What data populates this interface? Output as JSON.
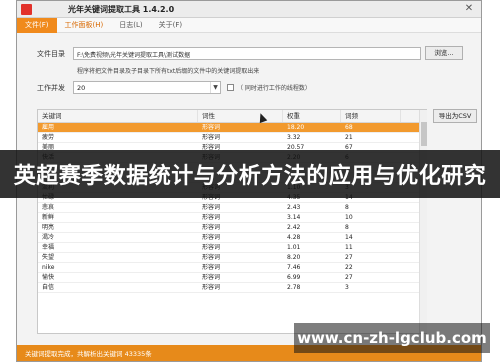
{
  "window": {
    "title": "光年关键词提取工具 1.4.2.0",
    "close_glyph": "✕"
  },
  "menu": [
    {
      "label": "文件(F)",
      "active": true
    },
    {
      "label": "工作面板(H)",
      "highlight": true
    },
    {
      "label": "日志(L)"
    },
    {
      "label": "关于(F)"
    }
  ],
  "form": {
    "dir_label": "文件目录",
    "dir_value": "F:\\免费视频\\光年关键词提取工具\\测试数据",
    "browse_label": "浏览...",
    "hint": "程序将把文件目录及子目录下所有txt后缀的文件中的关键词提取出来",
    "concurrency_label": "工作并发",
    "concurrency_value": "20",
    "checkbox_label": "（ 同时进行工作的线程数）"
  },
  "table": {
    "columns": [
      "关键词",
      "词性",
      "权重",
      "词频"
    ],
    "rows": [
      [
        "雇用",
        "形容词",
        "18.20",
        "68"
      ],
      [
        "疲劳",
        "形容词",
        "3.32",
        "21"
      ],
      [
        "美丽",
        "形容词",
        "20.57",
        "67"
      ],
      [
        "快活",
        "形容词",
        "2.20",
        "6"
      ],
      [
        "",
        "",
        "",
        ""
      ],
      [
        "",
        "",
        "",
        ""
      ],
      [
        "流利",
        "形容词",
        "1.10",
        "3"
      ],
      [
        "忙碌",
        "形容词",
        "4.35",
        "14"
      ],
      [
        "悲哀",
        "形容词",
        "2.43",
        "8"
      ],
      [
        "新鲜",
        "形容词",
        "3.14",
        "10"
      ],
      [
        "明亮",
        "形容词",
        "2.42",
        "8"
      ],
      [
        "渴冷",
        "形容词",
        "4.28",
        "14"
      ],
      [
        "幸福",
        "形容词",
        "1.01",
        "11"
      ],
      [
        "失望",
        "形容词",
        "8.20",
        "27"
      ],
      [
        "nike",
        "形容词",
        "7.46",
        "22"
      ],
      [
        "愉快",
        "形容词",
        "6.99",
        "27"
      ],
      [
        "自信",
        "形容词",
        "2.78",
        "3"
      ]
    ],
    "selected_row": 0
  },
  "export_label": "导出为CSV",
  "status": "关键词提取完成，共解析出关键词 43335条",
  "banner": "英超赛季数据统计与分析方法的应用与优化研究",
  "watermark": "www.cn-zh-lgclub.com",
  "colors": {
    "accent": "#f08a1c",
    "selected_row": "#f29a2e",
    "status_bar": "#e78a1a"
  }
}
